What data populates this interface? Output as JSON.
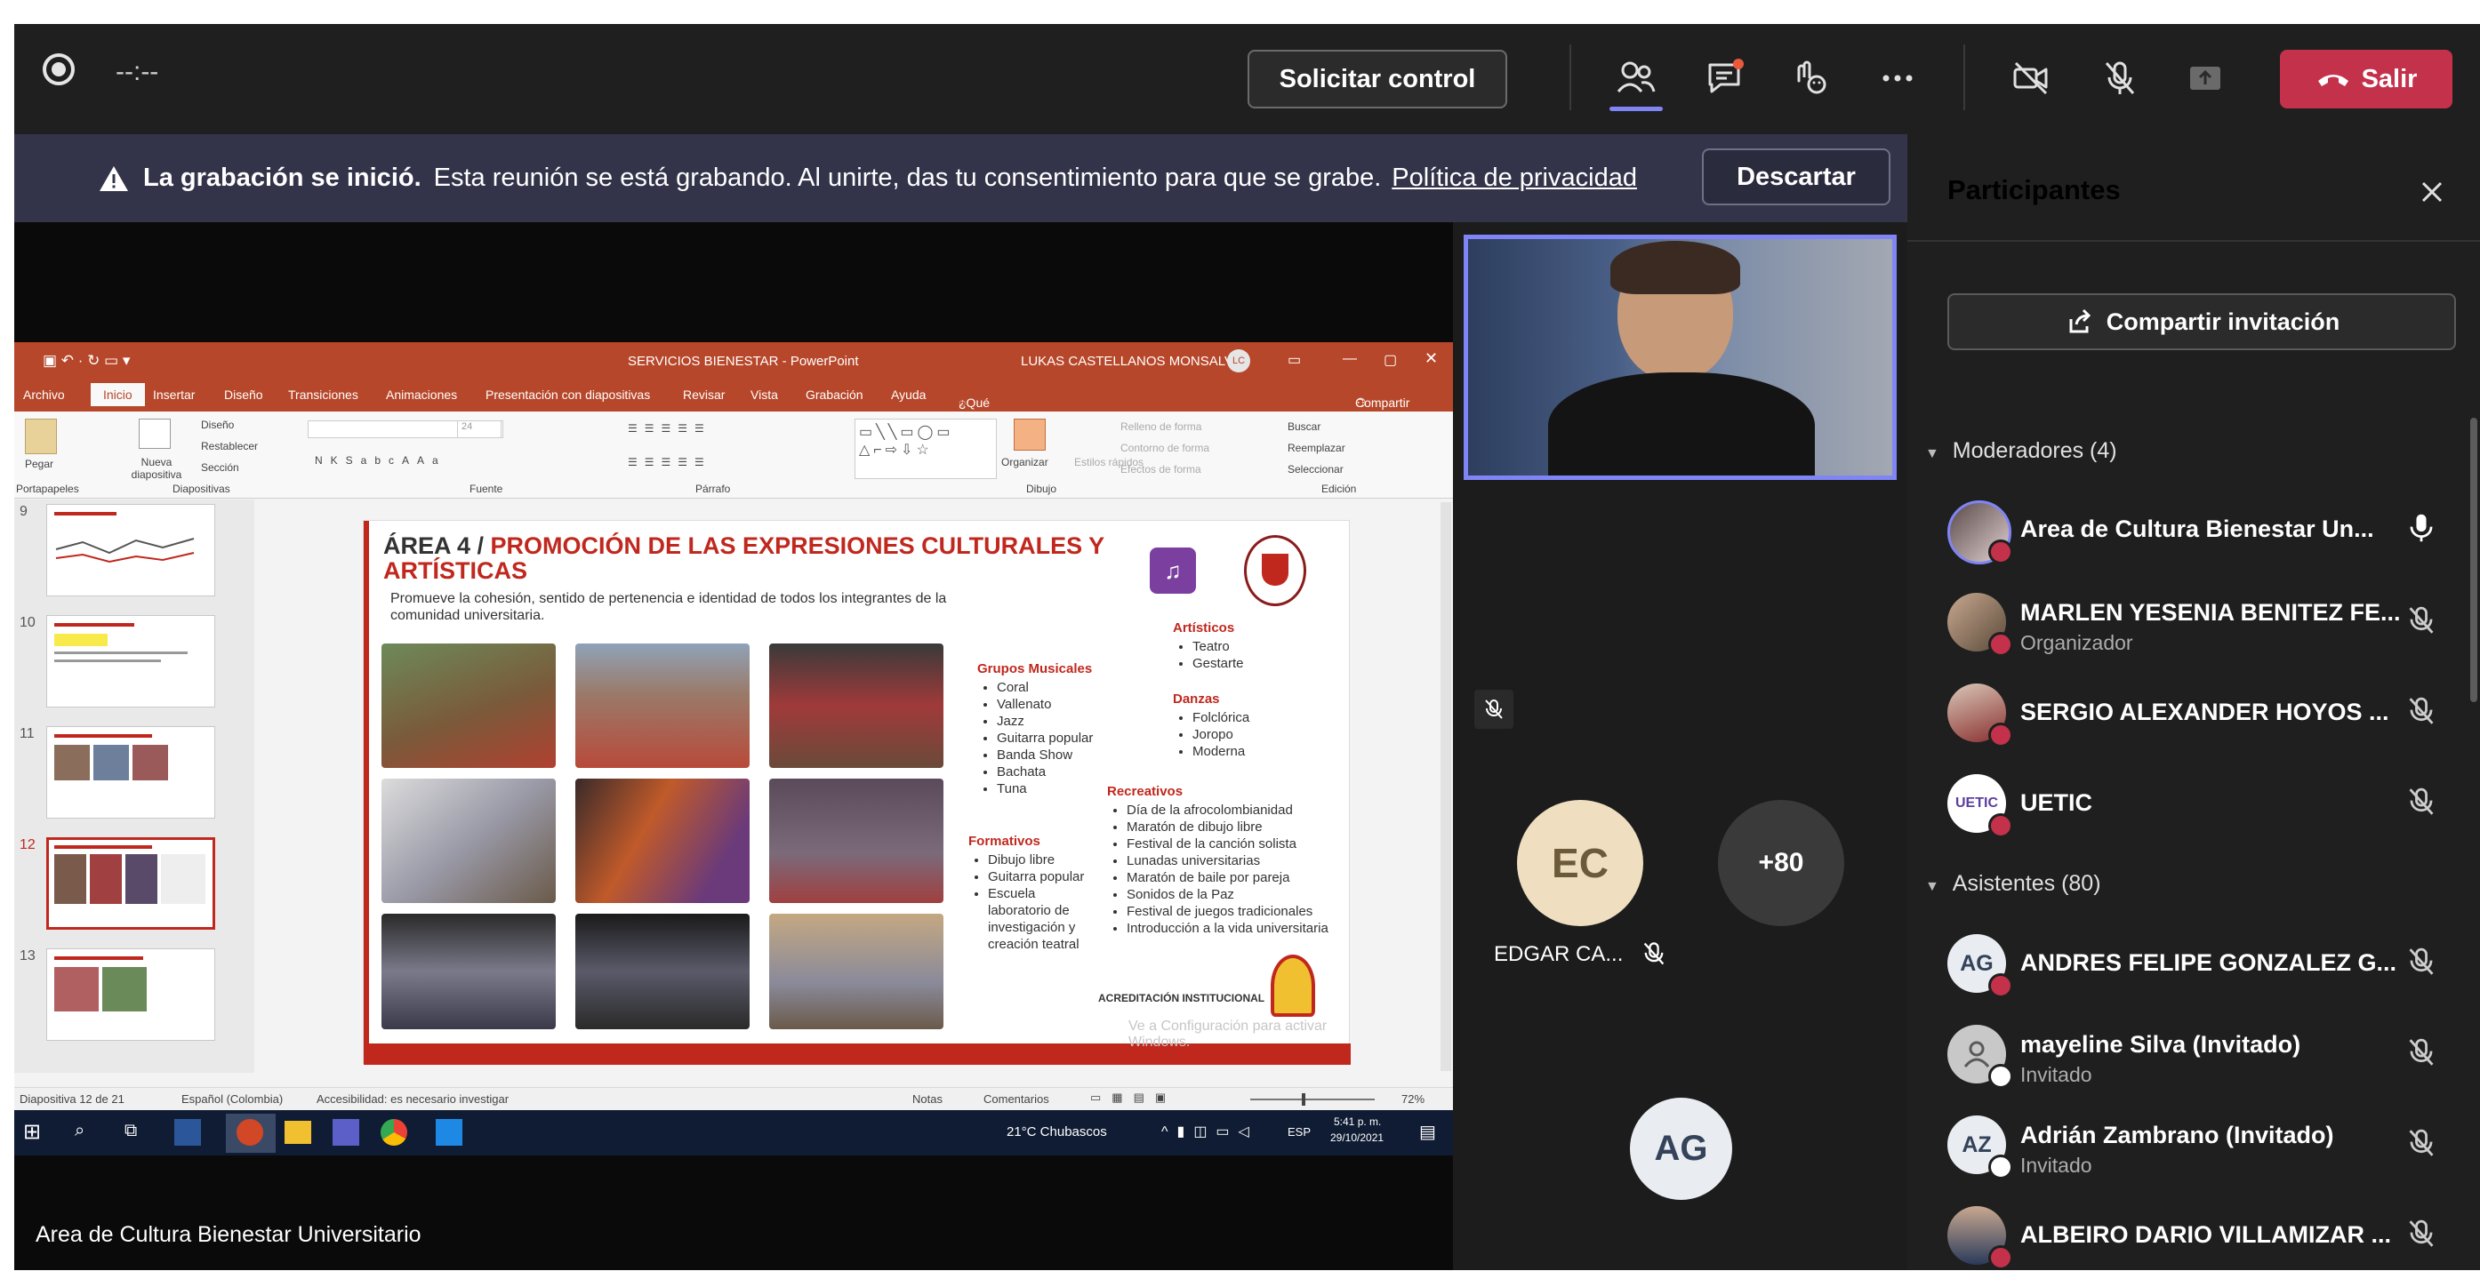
{
  "meeting": {
    "timer": "--:--",
    "request_control_label": "Solicitar control",
    "leave_label": "Salir",
    "accent_color": "#c4314b",
    "toolbar_icons": [
      "people-icon",
      "chat-icon",
      "reactions-icon",
      "more-icon",
      "camera-off-icon",
      "mic-off-icon",
      "share-icon"
    ]
  },
  "banner": {
    "title": "La grabación se inició.",
    "message": "Esta reunión se está grabando. Al unirte, das tu consentimiento para que se grabe.",
    "link": "Política de privacidad",
    "dismiss_label": "Descartar"
  },
  "presentation": {
    "window_title": "SERVICIOS BIENESTAR - PowerPoint",
    "user_name": "LUKAS CASTELLANOS MONSALVE",
    "user_initials": "LC",
    "tabs": [
      "Archivo",
      "Inicio",
      "Insertar",
      "Diseño",
      "Transiciones",
      "Animaciones",
      "Presentación con diapositivas",
      "Revisar",
      "Vista",
      "Grabación",
      "Ayuda",
      "¿Qué desea hacer?",
      "Compartir"
    ],
    "ribbon_groups": [
      "Portapapeles",
      "Diapositivas",
      "Fuente",
      "Párrafo",
      "Dibujo",
      "Edición"
    ],
    "ribbon_items": {
      "paste": "Pegar",
      "new_slide": "Nueva diapositiva",
      "layout": "Diseño",
      "reset": "Restablecer",
      "section": "Sección",
      "arrange": "Organizar",
      "quick_styles": "Estilos rápidos",
      "fill": "Relleno de forma",
      "outline": "Contorno de forma",
      "effects": "Efectos de forma",
      "find": "Buscar",
      "replace": "Reemplazar",
      "select": "Seleccionar"
    },
    "thumb_numbers": [
      "9",
      "10",
      "11",
      "12",
      "13"
    ],
    "status": {
      "slide": "Diapositiva 12 de 21",
      "language": "Español (Colombia)",
      "accessibility": "Accesibilidad: es necesario investigar",
      "notes": "Notas",
      "comments": "Comentarios",
      "zoom": "72%",
      "watermark": "Ve a Configuración para activar Windows."
    },
    "taskbar": {
      "weather": "21°C Chubascos",
      "lang": "ESP",
      "time": "5:41 p. m.",
      "date": "29/10/2021"
    },
    "slide": {
      "title_prefix": "ÁREA 4 /",
      "title_main": "PROMOCIÓN DE LAS EXPRESIONES CULTURALES Y ARTÍSTICAS",
      "subtitle": "Promueve la cohesión, sentido de pertenencia e identidad de todos los integrantes de la comunidad universitaria.",
      "musical_head": "Grupos Musicales",
      "musical_items": [
        "Coral",
        "Vallenato",
        "Jazz",
        "Guitarra popular",
        "Banda Show",
        "Bachata",
        "Tuna"
      ],
      "artistic_head": "Artísticos",
      "artistic_items": [
        "Teatro",
        "Gestarte"
      ],
      "dance_head": "Danzas",
      "dance_items": [
        "Folclórica",
        "Joropo",
        "Moderna"
      ],
      "formative_head": "Formativos",
      "formative_items": [
        "Dibujo libre",
        "Guitarra popular",
        "Escuela laboratorio de investigación y creación teatral"
      ],
      "recreational_head": "Recreativos",
      "recreational_items": [
        "Día de la afrocolombianidad",
        "Maratón de dibujo libre",
        "Festival de la canción solista",
        "Lunadas universitarias",
        "Maratón de baile por pareja",
        "Sonidos de la Paz",
        "Festival de juegos tradicionales",
        "Introducción a la vida universitaria"
      ],
      "accreditation": "ACREDITACIÓN INSTITUCIONAL"
    }
  },
  "stage": {
    "presenter_caption": "Area de Cultura Bienestar Universitario",
    "tiles": [
      {
        "initials": "EC",
        "name": "EDGAR CA..."
      },
      {
        "initials": "+80"
      },
      {
        "initials": "AG"
      }
    ]
  },
  "panel": {
    "title": "Participantes",
    "share_label": "Compartir invitación",
    "moderators_label": "Moderadores (4)",
    "attendees_label": "Asistentes (80)",
    "moderators": [
      {
        "name": "Area de Cultura Bienestar Un...",
        "sub": "",
        "mic": "on"
      },
      {
        "name": "MARLEN YESENIA BENITEZ FE...",
        "sub": "Organizador",
        "mic": "off"
      },
      {
        "name": "SERGIO ALEXANDER HOYOS ...",
        "sub": "",
        "mic": "off"
      },
      {
        "name": "UETIC",
        "sub": "",
        "mic": "off",
        "logo": "UETIC"
      }
    ],
    "attendees": [
      {
        "initials": "AG",
        "name": "ANDRES FELIPE GONZALEZ G...",
        "sub": ""
      },
      {
        "initials": "",
        "name": "mayeline Silva (Invitado)",
        "sub": "Invitado"
      },
      {
        "initials": "AZ",
        "name": "Adrián Zambrano (Invitado)",
        "sub": "Invitado"
      },
      {
        "initials": "",
        "name": "ALBEIRO DARIO VILLAMIZAR ...",
        "sub": ""
      }
    ]
  }
}
